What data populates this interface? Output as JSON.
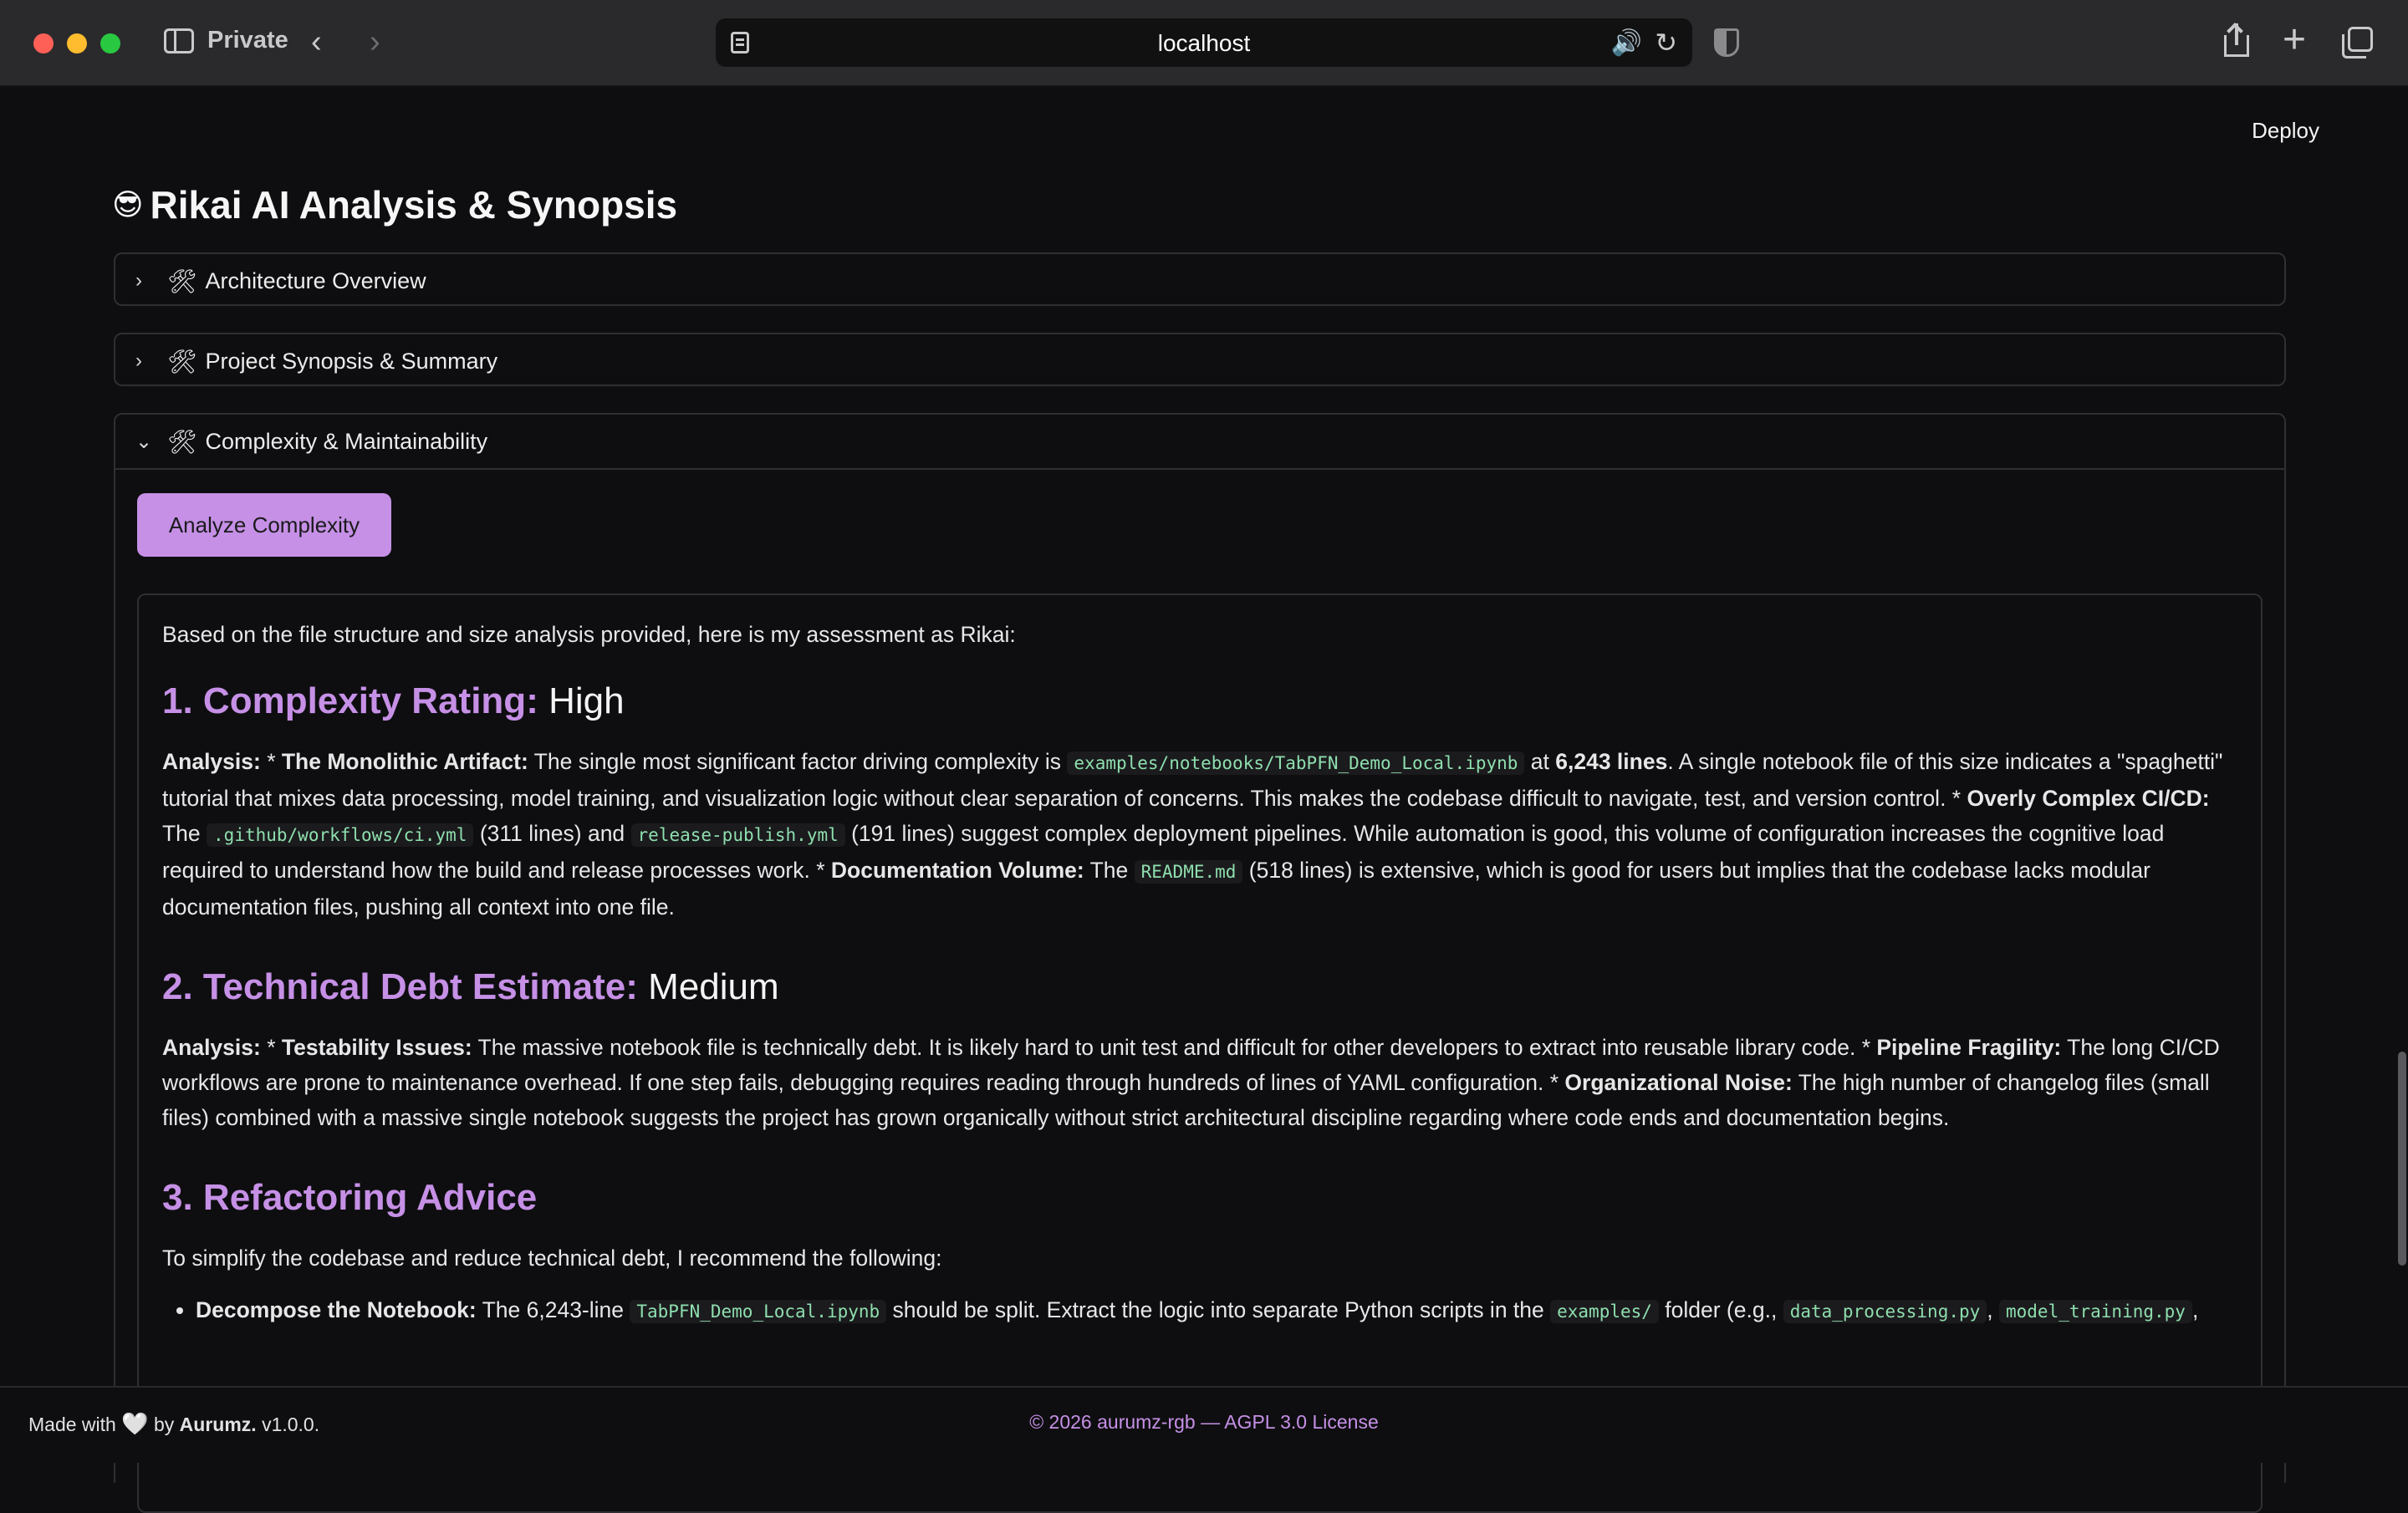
{
  "browser": {
    "mode_label": "Private",
    "url": "localhost"
  },
  "app": {
    "deploy_label": "Deploy",
    "title_emoji": "😎",
    "title": "Rikai AI Analysis & Synopsis",
    "sections": [
      {
        "label": "Architecture Overview",
        "expanded": false,
        "icon": "hammer-wrench-icon"
      },
      {
        "label": "Project Synopsis & Summary",
        "expanded": false,
        "icon": "hammer-wrench-icon"
      },
      {
        "label": "Complexity & Maintainability",
        "expanded": true,
        "icon": "hammer-wrench-icon"
      }
    ],
    "tool_glyph": "🛠",
    "chevron_right": "›",
    "chevron_down": "⌄",
    "analyze_button_label": "Analyze Complexity"
  },
  "result": {
    "intro": "Based on the file structure and size analysis provided, here is my assessment as Rikai:",
    "h1_label": "1. Complexity Rating:",
    "h1_value": "High",
    "p1": {
      "analysis": "Analysis:",
      "t0": " * ",
      "b1": "The Monolithic Artifact:",
      "t1": " The single most significant factor driving complexity is ",
      "c1": "examples/notebooks/TabPFN_Demo_Local.ipynb",
      "t2": " at ",
      "b2": "6,243 lines",
      "t3": ". A single notebook file of this size indicates a \"spaghetti\" tutorial that mixes data processing, model training, and visualization logic without clear separation of concerns. This makes the codebase difficult to navigate, test, and version control. * ",
      "b3": "Overly Complex CI/CD:",
      "t4": " The ",
      "c2": ".github/workflows/ci.yml",
      "t5": " (311 lines) and ",
      "c3": "release-publish.yml",
      "t6": " (191 lines) suggest complex deployment pipelines. While automation is good, this volume of configuration increases the cognitive load required to understand how the build and release processes work. * ",
      "b4": "Documentation Volume:",
      "t7": " The ",
      "c4": "README.md",
      "t8": " (518 lines) is extensive, which is good for users but implies that the codebase lacks modular documentation files, pushing all context into one file."
    },
    "h2_label": "2. Technical Debt Estimate:",
    "h2_value": "Medium",
    "p2": {
      "analysis": "Analysis:",
      "t0": " * ",
      "b1": "Testability Issues:",
      "t1": " The massive notebook file is technically debt. It is likely hard to unit test and difficult for other developers to extract into reusable library code. * ",
      "b2": "Pipeline Fragility:",
      "t2": " The long CI/CD workflows are prone to maintenance overhead. If one step fails, debugging requires reading through hundreds of lines of YAML configuration. * ",
      "b3": "Organizational Noise:",
      "t3": " The high number of changelog files (small files) combined with a massive single notebook suggests the project has grown organically without strict architectural discipline regarding where code ends and documentation begins."
    },
    "h3_label": "3. Refactoring Advice",
    "p3": "To simplify the codebase and reduce technical debt, I recommend the following:",
    "li1": {
      "b1": "Decompose the Notebook:",
      "t1": " The 6,243-line ",
      "c1": "TabPFN_Demo_Local.ipynb",
      "t2": " should be split. Extract the logic into separate Python scripts in the ",
      "c2": "examples/",
      "t3": " folder (e.g., ",
      "c3": "data_processing.py",
      "t4": ", ",
      "c4": "model_training.py",
      "t5": ","
    }
  },
  "footer": {
    "made_with": "Made with",
    "heart": "🤍",
    "by": "by",
    "author": "Aurumz.",
    "version": "v1.0.0.",
    "copyright": "© 2026 aurumz-rgb — AGPL 3.0 License"
  }
}
